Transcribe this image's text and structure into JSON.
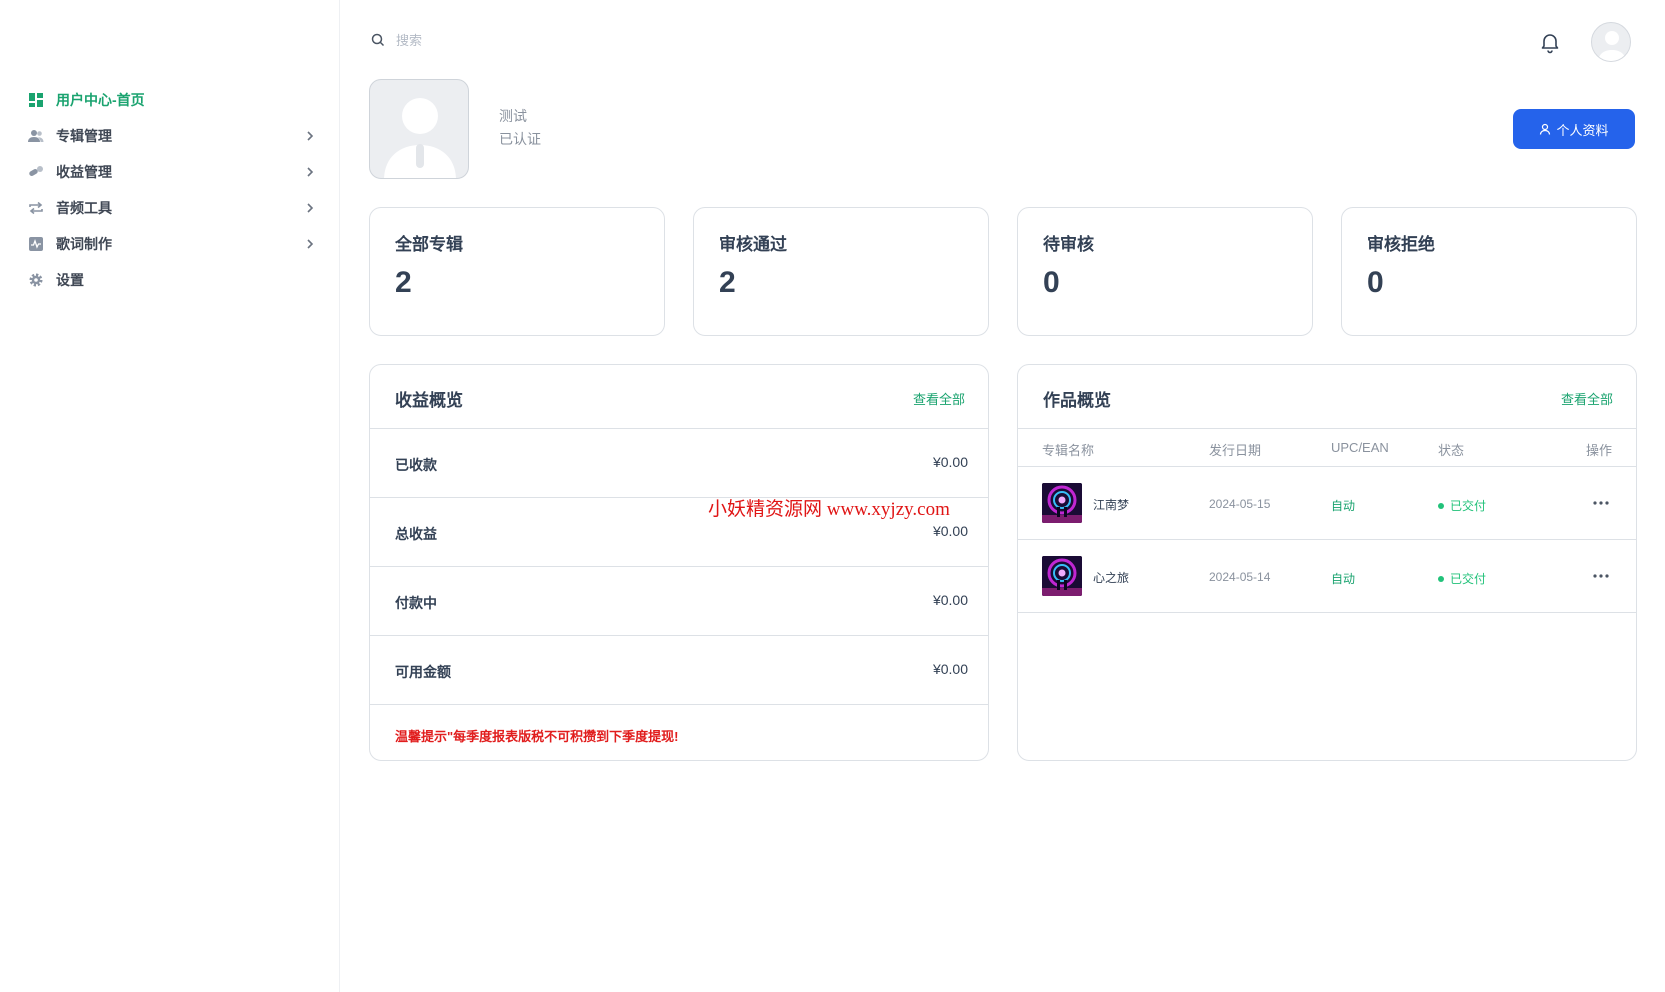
{
  "sidebar": {
    "items": [
      {
        "label": "用户中心-首页",
        "icon": "dashboard-icon",
        "active": true
      },
      {
        "label": "专辑管理",
        "icon": "users-icon"
      },
      {
        "label": "收益管理",
        "icon": "pills-icon"
      },
      {
        "label": "音频工具",
        "icon": "repeat-icon"
      },
      {
        "label": "歌词制作",
        "icon": "pulse-icon"
      },
      {
        "label": "设置",
        "icon": "gear-icon"
      }
    ]
  },
  "header": {
    "search_placeholder": "搜索"
  },
  "profile": {
    "name": "测试",
    "status": "已认证",
    "button_label": "个人资料"
  },
  "stats": [
    {
      "label": "全部专辑",
      "value": "2"
    },
    {
      "label": "审核通过",
      "value": "2"
    },
    {
      "label": "待审核",
      "value": "0"
    },
    {
      "label": "审核拒绝",
      "value": "0"
    }
  ],
  "earnings": {
    "title": "收益概览",
    "view_all": "查看全部",
    "rows": [
      {
        "label": "已收款",
        "value": "¥0.00"
      },
      {
        "label": "总收益",
        "value": "¥0.00"
      },
      {
        "label": "付款中",
        "value": "¥0.00"
      },
      {
        "label": "可用金额",
        "value": "¥0.00"
      }
    ],
    "tip": "温馨提示\"每季度报表版税不可积攒到下季度提现!"
  },
  "works": {
    "title": "作品概览",
    "view_all": "查看全部",
    "columns": [
      "专辑名称",
      "发行日期",
      "UPC/EAN",
      "状态",
      "操作"
    ],
    "rows": [
      {
        "name": "江南梦",
        "date": "2024-05-15",
        "upc": "自动",
        "status": "已交付"
      },
      {
        "name": "心之旅",
        "date": "2024-05-14",
        "upc": "自动",
        "status": "已交付"
      }
    ]
  },
  "watermark": "小妖精资源网 www.xyjzy.com",
  "colors": {
    "accent_green": "#1aa36f",
    "primary_blue": "#2563eb",
    "tip_red": "#e11d1d",
    "status_green": "#22c27a"
  }
}
